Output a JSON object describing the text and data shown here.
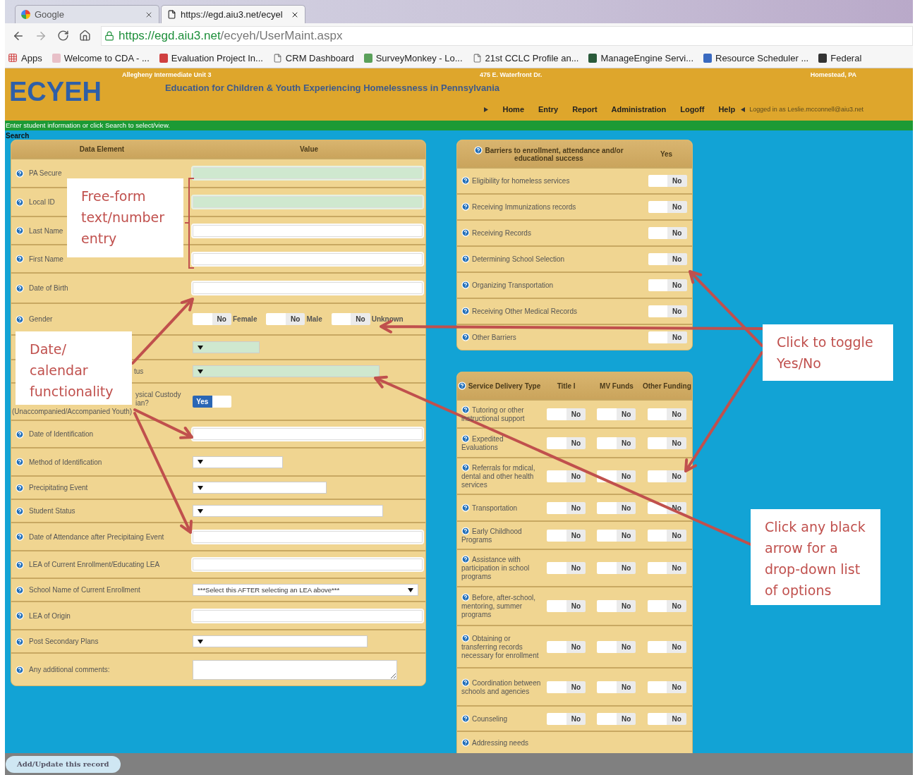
{
  "browser": {
    "tabs": [
      {
        "title": "Google",
        "selected": false
      },
      {
        "title": "https://egd.aiu3.net/ecyel",
        "selected": true
      }
    ],
    "url": {
      "host": "https://egd.aiu3.net",
      "path": "/ecyeh/UserMaint.aspx"
    },
    "bookmarks": [
      {
        "label": "Apps"
      },
      {
        "label": "Welcome to CDA - ..."
      },
      {
        "label": "Evaluation Project In..."
      },
      {
        "label": "CRM Dashboard"
      },
      {
        "label": "SurveyMonkey - Lo..."
      },
      {
        "label": "21st CCLC Profile an..."
      },
      {
        "label": "ManageEngine Servi..."
      },
      {
        "label": "Resource Scheduler ..."
      },
      {
        "label": "Federal"
      }
    ]
  },
  "header": {
    "address_line": [
      "Allegheny Intermediate Unit 3",
      "475 E. Waterfront Dr.",
      "Homestead, PA"
    ],
    "logo": "ECYEH",
    "title": "Education for Children & Youth Experiencing Homelessness in Pennsylvania",
    "nav": [
      "Home",
      "Entry",
      "Report",
      "Administration",
      "Logoff",
      "Help"
    ],
    "login": "Logged in as Leslie.mcconnell@aiu3.net"
  },
  "notice": "Enter student information or click Search to select/view.",
  "section_title": "Search",
  "form": {
    "columns": [
      "Data Element",
      "Value"
    ],
    "rows": [
      {
        "label": "PA Secure",
        "kind": "text",
        "required": true
      },
      {
        "label": "Local ID",
        "kind": "text",
        "required": true
      },
      {
        "label": "Last Name",
        "kind": "text",
        "required": false
      },
      {
        "label": "First Name",
        "kind": "text",
        "required": false
      },
      {
        "label": "Date of Birth",
        "kind": "text",
        "required": false
      },
      {
        "label": "Gender",
        "kind": "choices",
        "options": [
          {
            "label": "Female",
            "toggle": {
              "text": "No",
              "on": false
            }
          },
          {
            "label": "Male",
            "toggle": {
              "text": "No",
              "on": false
            }
          },
          {
            "label": "Unknown",
            "toggle": {
              "text": "No",
              "on": false
            }
          }
        ]
      },
      {
        "kind": "select",
        "required": true
      },
      {
        "label": "tus",
        "kind": "select",
        "required": true
      },
      {
        "label_lines": [
          "ysical Custody",
          "ian?",
          "(Unaccompanied/Accompanied Youth)"
        ],
        "kind": "toggle",
        "toggle": {
          "text": "Yes",
          "on": true
        }
      },
      {
        "label": "Date of Identification",
        "kind": "text",
        "required": false
      },
      {
        "label": "Method of Identification",
        "kind": "select",
        "required": false
      },
      {
        "label": "Precipitating Event",
        "kind": "select",
        "required": false
      },
      {
        "label": "Student Status",
        "kind": "select",
        "required": false
      },
      {
        "label": "Date of Attendance after Precipitaing Event",
        "kind": "text",
        "required": false
      },
      {
        "label": "LEA of Current Enrollment/Educating LEA",
        "kind": "text",
        "required": false
      },
      {
        "label": "School Name of Current Enrollment",
        "kind": "select",
        "required": false,
        "value": "***Select this AFTER selecting an LEA above***"
      },
      {
        "label": "LEA of Origin",
        "kind": "text",
        "required": false
      },
      {
        "label": "Post Secondary Plans",
        "kind": "select",
        "required": false
      },
      {
        "label": "Any additional comments:",
        "kind": "textarea"
      }
    ]
  },
  "barriers": {
    "columns": [
      "Barriers to enrollment, attendance and/or educational success",
      "Yes"
    ],
    "rows": [
      {
        "label": "Eligibility for homeless services",
        "toggle": {
          "text": "No",
          "on": false
        }
      },
      {
        "label": "Receiving Immunizations records",
        "toggle": {
          "text": "No",
          "on": false
        }
      },
      {
        "label": "Receiving Records",
        "toggle": {
          "text": "No",
          "on": false
        }
      },
      {
        "label": "Determining School Selection",
        "toggle": {
          "text": "No",
          "on": false
        }
      },
      {
        "label": "Organizing Transportation",
        "toggle": {
          "text": "No",
          "on": false
        }
      },
      {
        "label": "Receiving Other Medical Records",
        "toggle": {
          "text": "No",
          "on": false
        }
      },
      {
        "label": "Other Barriers",
        "toggle": {
          "text": "No",
          "on": false
        }
      }
    ]
  },
  "services": {
    "columns": [
      "Service Delivery Type",
      "Title I",
      "MV Funds",
      "Other Funding"
    ],
    "rows": [
      {
        "label": "Tutoring or other instructional support",
        "toggles": [
          {
            "text": "No",
            "on": false
          },
          {
            "text": "No",
            "on": false
          },
          {
            "text": "No",
            "on": false
          }
        ]
      },
      {
        "label": "Expedited Evaluations",
        "toggles": [
          {
            "text": "No",
            "on": false
          },
          {
            "text": "No",
            "on": false
          },
          {
            "text": "No",
            "on": false
          }
        ]
      },
      {
        "label": "Referrals for mdical, dental and other health services",
        "toggles": [
          {
            "text": "No",
            "on": false
          },
          {
            "text": "No",
            "on": false
          },
          {
            "text": "No",
            "on": false
          }
        ]
      },
      {
        "label": "Transportation",
        "toggles": [
          {
            "text": "No",
            "on": false
          },
          {
            "text": "No",
            "on": false
          },
          {
            "text": "No",
            "on": false
          }
        ]
      },
      {
        "label": "Early Childhood Programs",
        "toggles": [
          {
            "text": "No",
            "on": false
          },
          {
            "text": "No",
            "on": false
          },
          {
            "text": "No",
            "on": false
          }
        ]
      },
      {
        "label": "Assistance with participation in school programs",
        "toggles": [
          {
            "text": "No",
            "on": false
          },
          {
            "text": "No",
            "on": false
          },
          {
            "text": "No",
            "on": false
          }
        ]
      },
      {
        "label": "Before, after-school, mentoring, summer programs",
        "toggles": [
          {
            "text": "No",
            "on": false
          },
          {
            "text": "No",
            "on": false
          },
          {
            "text": "No",
            "on": false
          }
        ]
      },
      {
        "label": "Obtaining or transferring records necessary for enrollment",
        "toggles": [
          {
            "text": "No",
            "on": false
          },
          {
            "text": "No",
            "on": false
          },
          {
            "text": "No",
            "on": false
          }
        ]
      },
      {
        "label": "Coordination between schools and agencies",
        "toggles": [
          {
            "text": "No",
            "on": false
          },
          {
            "text": "No",
            "on": false
          },
          {
            "text": "No",
            "on": false
          }
        ]
      },
      {
        "label": "Counseling",
        "toggles": [
          {
            "text": "No",
            "on": false
          },
          {
            "text": "No",
            "on": false
          },
          {
            "text": "No",
            "on": false
          }
        ]
      },
      {
        "label": "Addressing needs"
      }
    ]
  },
  "footer": {
    "button": "Add/Update this record"
  },
  "callouts": [
    {
      "text": "Free-form text/number entry"
    },
    {
      "text": "Date/ calendar functionality"
    },
    {
      "text": "Click to toggle Yes/No"
    },
    {
      "text": "Click any black arrow for a drop-down list of options"
    }
  ]
}
